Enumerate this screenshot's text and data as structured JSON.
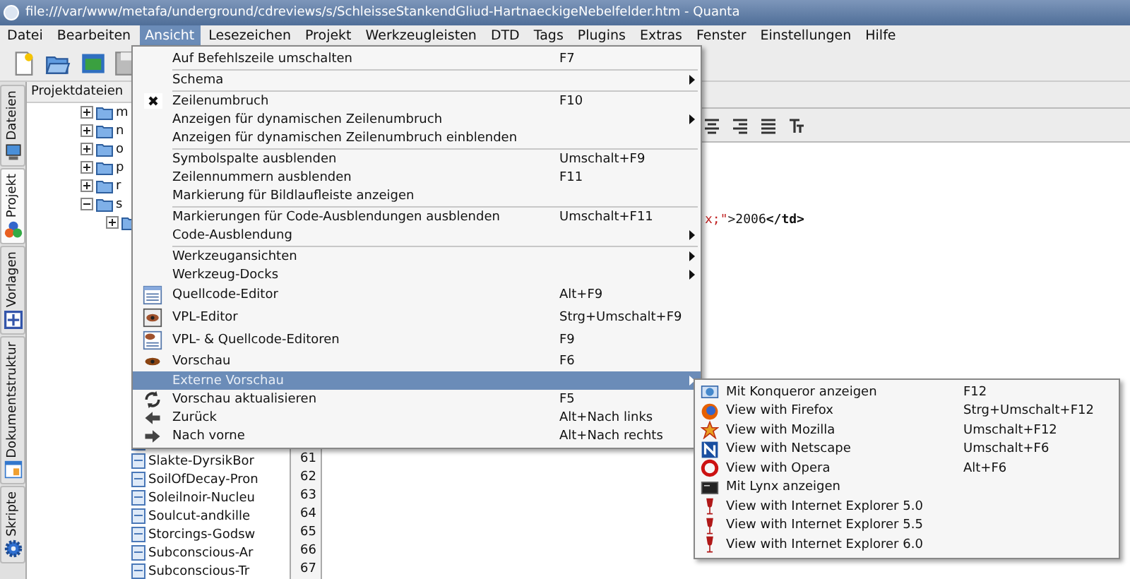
{
  "window": {
    "title": "file:///var/www/metafa/underground/cdreviews/s/SchleisseStankendGliud-HartnaeckigeNebelfelder.htm - Quanta"
  },
  "menubar": [
    {
      "label": "Datei",
      "selected": false
    },
    {
      "label": "Bearbeiten",
      "selected": false
    },
    {
      "label": "Ansicht",
      "selected": true
    },
    {
      "label": "Lesezeichen",
      "selected": false
    },
    {
      "label": "Projekt",
      "selected": false
    },
    {
      "label": "Werkzeugleisten",
      "selected": false
    },
    {
      "label": "DTD",
      "selected": false
    },
    {
      "label": "Tags",
      "selected": false
    },
    {
      "label": "Plugins",
      "selected": false
    },
    {
      "label": "Extras",
      "selected": false
    },
    {
      "label": "Fenster",
      "selected": false
    },
    {
      "label": "Einstellungen",
      "selected": false
    },
    {
      "label": "Hilfe",
      "selected": false
    }
  ],
  "side_tabs": [
    {
      "label": "Dateien",
      "selected": false
    },
    {
      "label": "Projekt",
      "selected": true
    },
    {
      "label": "Vorlagen",
      "selected": false
    },
    {
      "label": "Dokumentstruktur",
      "selected": false
    },
    {
      "label": "Skripte",
      "selected": false
    }
  ],
  "project_panel": {
    "title": "Projektdateien",
    "folders": [
      {
        "name": "m",
        "expanded": false
      },
      {
        "name": "n",
        "expanded": false
      },
      {
        "name": "o",
        "expanded": false
      },
      {
        "name": "p",
        "expanded": false
      },
      {
        "name": "r",
        "expanded": false
      },
      {
        "name": "s",
        "expanded": true
      }
    ],
    "files": [
      "Slakte-DyrsikBor",
      "SoilOfDecay-Pron",
      "Soleilnoir-Nucleu",
      "Soulcut-andkille",
      "Storcings-Godsw",
      "Subconscious-Ar",
      "Subconscious-Tr"
    ]
  },
  "editor": {
    "code_line": [
      {
        "kind": "attr",
        "text": "x;\""
      },
      {
        "kind": "text",
        "text": ">2006"
      },
      {
        "kind": "tag",
        "text": "</td>"
      }
    ],
    "line_numbers": [
      "61",
      "62",
      "63",
      "64",
      "65",
      "66",
      "67"
    ]
  },
  "view_menu": [
    {
      "kind": "item",
      "label": "Auf Befehlszeile umschalten",
      "shortcut": "F7",
      "submenu": false,
      "selected": false
    },
    {
      "kind": "separator"
    },
    {
      "kind": "item",
      "label": "Schema",
      "submenu": true,
      "selected": false
    },
    {
      "kind": "separator"
    },
    {
      "kind": "check",
      "label": "Zeilenumbruch",
      "shortcut": "F10",
      "checked": true,
      "submenu": false,
      "selected": false
    },
    {
      "kind": "item",
      "label": "Anzeigen für dynamischen Zeilenumbruch",
      "submenu": true,
      "selected": false
    },
    {
      "kind": "item",
      "label": "Anzeigen für dynamischen Zeilenumbruch einblenden",
      "submenu": false,
      "selected": false
    },
    {
      "kind": "separator"
    },
    {
      "kind": "item",
      "label": "Symbolspalte ausblenden",
      "shortcut": "Umschalt+F9",
      "submenu": false,
      "selected": false
    },
    {
      "kind": "item",
      "label": "Zeilennummern ausblenden",
      "shortcut": "F11",
      "submenu": false,
      "selected": false
    },
    {
      "kind": "item",
      "label": "Markierung für Bildlaufleiste anzeigen",
      "submenu": false,
      "selected": false
    },
    {
      "kind": "separator"
    },
    {
      "kind": "item",
      "label": "Markierungen für Code-Ausblendungen ausblenden",
      "shortcut": "Umschalt+F11",
      "submenu": false,
      "selected": false
    },
    {
      "kind": "item",
      "label": "Code-Ausblendung",
      "submenu": true,
      "selected": false
    },
    {
      "kind": "separator"
    },
    {
      "kind": "item",
      "label": "Werkzeugansichten",
      "submenu": true,
      "selected": false
    },
    {
      "kind": "item",
      "label": "Werkzeug-Docks",
      "submenu": true,
      "selected": false
    },
    {
      "kind": "item",
      "label": "Quellcode-Editor",
      "shortcut": "Alt+F9",
      "submenu": false,
      "selected": false
    },
    {
      "kind": "item",
      "label": "VPL-Editor",
      "shortcut": "Strg+Umschalt+F9",
      "submenu": false,
      "selected": false
    },
    {
      "kind": "item",
      "label": "VPL- & Quellcode-Editoren",
      "shortcut": "F9",
      "submenu": false,
      "selected": false
    },
    {
      "kind": "item",
      "label": "Vorschau",
      "shortcut": "F6",
      "submenu": false,
      "selected": false
    },
    {
      "kind": "item",
      "label": "Externe Vorschau",
      "submenu": true,
      "selected": true
    },
    {
      "kind": "item",
      "label": "Vorschau aktualisieren",
      "shortcut": "F5",
      "submenu": false,
      "selected": false
    },
    {
      "kind": "item",
      "label": "Zurück",
      "shortcut": "Alt+Nach links",
      "submenu": false,
      "selected": false
    },
    {
      "kind": "item",
      "label": "Nach vorne",
      "shortcut": "Alt+Nach rechts",
      "submenu": false,
      "selected": false
    }
  ],
  "preview_submenu": [
    {
      "label": "Mit Konqueror anzeigen",
      "shortcut": "F12"
    },
    {
      "label": "View with Firefox",
      "shortcut": "Strg+Umschalt+F12"
    },
    {
      "label": "View with Mozilla",
      "shortcut": "Umschalt+F12"
    },
    {
      "label": "View with Netscape",
      "shortcut": "Umschalt+F6"
    },
    {
      "label": "View with Opera",
      "shortcut": "Alt+F6"
    },
    {
      "label": "Mit Lynx anzeigen"
    },
    {
      "label": "View with Internet Explorer 5.0"
    },
    {
      "label": "View with Internet Explorer 5.5"
    },
    {
      "label": "View with Internet Explorer 6.0"
    }
  ]
}
